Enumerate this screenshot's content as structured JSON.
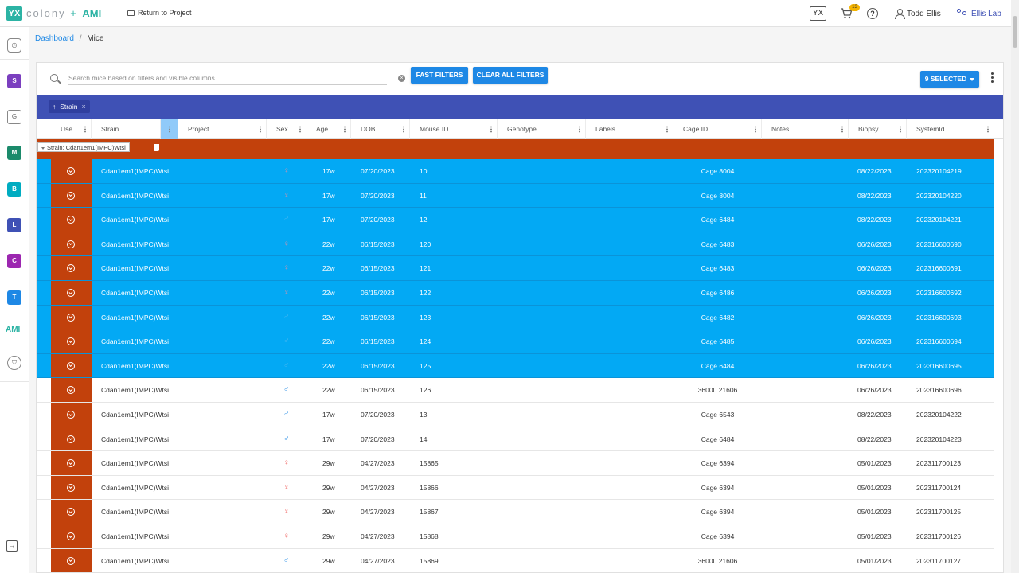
{
  "app": {
    "logo_mark": "YX",
    "logo_name": "colony",
    "logo_plus": "+",
    "logo_ami": "AMI"
  },
  "topbar": {
    "return_link": "Return to Project",
    "yx_badge": "YX",
    "cart_count": "13",
    "help": "?",
    "user_name": "Todd Ellis",
    "lab_name": "Ellis Lab"
  },
  "leftrail": {
    "items": [
      {
        "letter": "S",
        "color": "#7b3fbf"
      },
      {
        "letter": "G",
        "color": "outline"
      },
      {
        "letter": "M",
        "color": "#1b8a6b"
      },
      {
        "letter": "B",
        "color": "#00acc1"
      },
      {
        "letter": "L",
        "color": "#3f51b5"
      },
      {
        "letter": "C",
        "color": "#9c27b0"
      },
      {
        "letter": "T",
        "color": "#1e88e5"
      }
    ],
    "ami_label": "AMI"
  },
  "breadcrumb": {
    "dashboard": "Dashboard",
    "separator": "/",
    "current": "Mice"
  },
  "toolbar": {
    "search_placeholder": "Search mice based on filters and visible columns...",
    "fast_filters": "FAST FILTERS",
    "clear_filters": "CLEAR ALL FILTERS",
    "selected_label": "9 SELECTED"
  },
  "group_chip": {
    "arrow": "↑",
    "label": "Strain",
    "close": "×"
  },
  "columns": [
    "Use",
    "Strain",
    "",
    "Project",
    "Sex",
    "Age",
    "DOB",
    "Mouse ID",
    "Genotype",
    "Labels",
    "Cage ID",
    "Notes",
    "Biopsy ...",
    "SystemId"
  ],
  "group_row": {
    "label": "Strain: Cdan1em1(IMPC)Wtsi"
  },
  "rows": [
    {
      "strain": "Cdan1em1(IMPC)Wtsi",
      "sex": "♀",
      "sex_code": "f",
      "age": "17w",
      "dob": "07/20/2023",
      "mouse_id": "10",
      "cage_id": "Cage 8004",
      "biopsy": "08/22/2023",
      "system_id": "202320104219",
      "selected": true
    },
    {
      "strain": "Cdan1em1(IMPC)Wtsi",
      "sex": "♀",
      "sex_code": "f",
      "age": "17w",
      "dob": "07/20/2023",
      "mouse_id": "11",
      "cage_id": "Cage 8004",
      "biopsy": "08/22/2023",
      "system_id": "202320104220",
      "selected": true
    },
    {
      "strain": "Cdan1em1(IMPC)Wtsi",
      "sex": "♂",
      "sex_code": "m",
      "age": "17w",
      "dob": "07/20/2023",
      "mouse_id": "12",
      "cage_id": "Cage 6484",
      "biopsy": "08/22/2023",
      "system_id": "202320104221",
      "selected": true
    },
    {
      "strain": "Cdan1em1(IMPC)Wtsi",
      "sex": "♀",
      "sex_code": "f",
      "age": "22w",
      "dob": "06/15/2023",
      "mouse_id": "120",
      "cage_id": "Cage 6483",
      "biopsy": "06/26/2023",
      "system_id": "202316600690",
      "selected": true
    },
    {
      "strain": "Cdan1em1(IMPC)Wtsi",
      "sex": "♀",
      "sex_code": "f",
      "age": "22w",
      "dob": "06/15/2023",
      "mouse_id": "121",
      "cage_id": "Cage 6483",
      "biopsy": "06/26/2023",
      "system_id": "202316600691",
      "selected": true
    },
    {
      "strain": "Cdan1em1(IMPC)Wtsi",
      "sex": "♀",
      "sex_code": "f",
      "age": "22w",
      "dob": "06/15/2023",
      "mouse_id": "122",
      "cage_id": "Cage 6486",
      "biopsy": "06/26/2023",
      "system_id": "202316600692",
      "selected": true
    },
    {
      "strain": "Cdan1em1(IMPC)Wtsi",
      "sex": "♂",
      "sex_code": "m",
      "age": "22w",
      "dob": "06/15/2023",
      "mouse_id": "123",
      "cage_id": "Cage 6482",
      "biopsy": "06/26/2023",
      "system_id": "202316600693",
      "selected": true
    },
    {
      "strain": "Cdan1em1(IMPC)Wtsi",
      "sex": "♂",
      "sex_code": "m",
      "age": "22w",
      "dob": "06/15/2023",
      "mouse_id": "124",
      "cage_id": "Cage 6485",
      "biopsy": "06/26/2023",
      "system_id": "202316600694",
      "selected": true
    },
    {
      "strain": "Cdan1em1(IMPC)Wtsi",
      "sex": "♂",
      "sex_code": "m",
      "age": "22w",
      "dob": "06/15/2023",
      "mouse_id": "125",
      "cage_id": "Cage 6484",
      "biopsy": "06/26/2023",
      "system_id": "202316600695",
      "selected": true
    },
    {
      "strain": "Cdan1em1(IMPC)Wtsi",
      "sex": "♂",
      "sex_code": "m",
      "age": "22w",
      "dob": "06/15/2023",
      "mouse_id": "126",
      "cage_id": "36000 21606",
      "biopsy": "06/26/2023",
      "system_id": "202316600696",
      "selected": false
    },
    {
      "strain": "Cdan1em1(IMPC)Wtsi",
      "sex": "♂",
      "sex_code": "m",
      "age": "17w",
      "dob": "07/20/2023",
      "mouse_id": "13",
      "cage_id": "Cage 6543",
      "biopsy": "08/22/2023",
      "system_id": "202320104222",
      "selected": false
    },
    {
      "strain": "Cdan1em1(IMPC)Wtsi",
      "sex": "♂",
      "sex_code": "m",
      "age": "17w",
      "dob": "07/20/2023",
      "mouse_id": "14",
      "cage_id": "Cage 6484",
      "biopsy": "08/22/2023",
      "system_id": "202320104223",
      "selected": false
    },
    {
      "strain": "Cdan1em1(IMPC)Wtsi",
      "sex": "♀",
      "sex_code": "f",
      "age": "29w",
      "dob": "04/27/2023",
      "mouse_id": "15865",
      "cage_id": "Cage 6394",
      "biopsy": "05/01/2023",
      "system_id": "202311700123",
      "selected": false
    },
    {
      "strain": "Cdan1em1(IMPC)Wtsi",
      "sex": "♀",
      "sex_code": "f",
      "age": "29w",
      "dob": "04/27/2023",
      "mouse_id": "15866",
      "cage_id": "Cage 6394",
      "biopsy": "05/01/2023",
      "system_id": "202311700124",
      "selected": false
    },
    {
      "strain": "Cdan1em1(IMPC)Wtsi",
      "sex": "♀",
      "sex_code": "f",
      "age": "29w",
      "dob": "04/27/2023",
      "mouse_id": "15867",
      "cage_id": "Cage 6394",
      "biopsy": "05/01/2023",
      "system_id": "202311700125",
      "selected": false
    },
    {
      "strain": "Cdan1em1(IMPC)Wtsi",
      "sex": "♀",
      "sex_code": "f",
      "age": "29w",
      "dob": "04/27/2023",
      "mouse_id": "15868",
      "cage_id": "Cage 6394",
      "biopsy": "05/01/2023",
      "system_id": "202311700126",
      "selected": false
    },
    {
      "strain": "Cdan1em1(IMPC)Wtsi",
      "sex": "♂",
      "sex_code": "m",
      "age": "29w",
      "dob": "04/27/2023",
      "mouse_id": "15869",
      "cage_id": "36000 21606",
      "biopsy": "05/01/2023",
      "system_id": "202311700127",
      "selected": false
    }
  ],
  "colors": {
    "accent": "#1e88e5",
    "group_bar": "#3f51b5",
    "group_row": "#c2410c",
    "selected_row": "#03a9f4",
    "brand": "#2cb3a4"
  }
}
